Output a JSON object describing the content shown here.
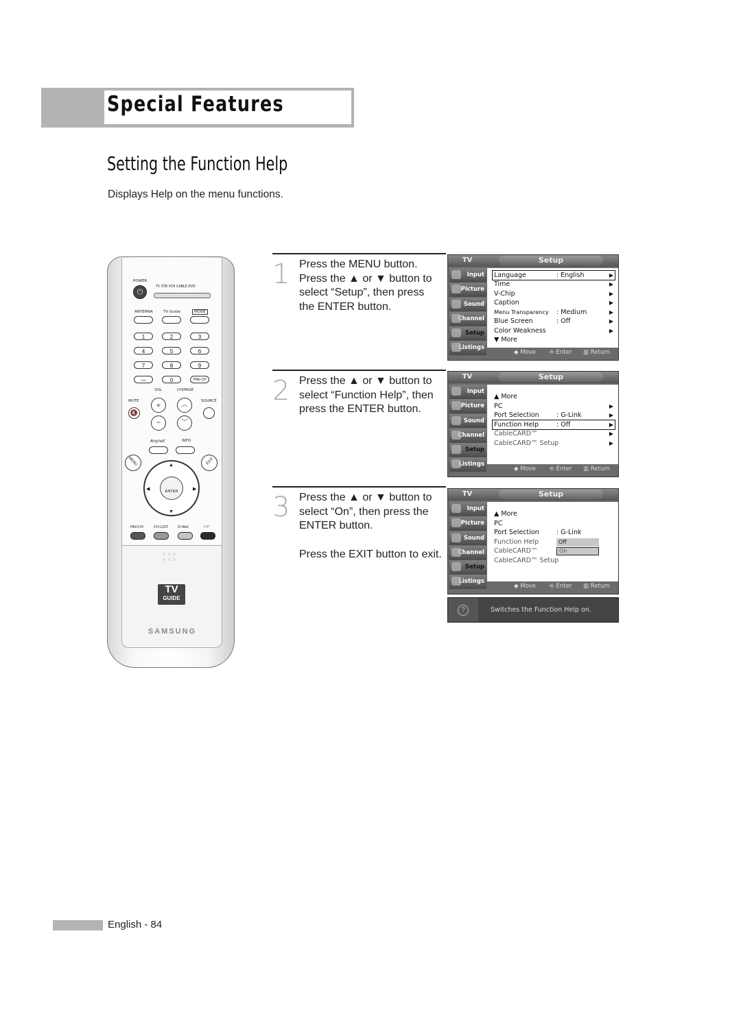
{
  "header": {
    "section": "Special Features"
  },
  "page": {
    "title": "Setting the Function Help",
    "intro": "Displays Help on the menu functions."
  },
  "steps": [
    {
      "number": "1",
      "lines": [
        "Press the MENU button.",
        "Press the ▲ or ▼ button to",
        "select “Setup”, then press",
        "the ENTER button."
      ]
    },
    {
      "number": "2",
      "lines": [
        "Press the ▲ or ▼ button to",
        "select “Function Help”, then",
        "press the ENTER button."
      ]
    },
    {
      "number": "3",
      "lines": [
        "Press the ▲ or ▼ button to",
        "select “On”, then press the",
        "ENTER button."
      ],
      "extra": "Press the EXIT button to exit."
    }
  ],
  "osd": {
    "tv_label": "TV",
    "title": "Setup",
    "sidebar": [
      "Input",
      "Picture",
      "Sound",
      "Channel",
      "Setup",
      "Listings"
    ],
    "hints": {
      "move": "◆ Move",
      "enter": "Enter",
      "return": "Return"
    },
    "screen1": [
      {
        "label": "Language",
        "value": ": English",
        "arrow": "▶"
      },
      {
        "label": "Time",
        "value": "",
        "arrow": "▶"
      },
      {
        "label": "V-Chip",
        "value": "",
        "arrow": "▶"
      },
      {
        "label": "Caption",
        "value": "",
        "arrow": "▶"
      },
      {
        "label": "Menu Transparency",
        "value": ": Medium",
        "arrow": "▶"
      },
      {
        "label": "Blue Screen",
        "value": ": Off",
        "arrow": "▶"
      },
      {
        "label": "Color Weakness",
        "value": "",
        "arrow": "▶"
      },
      {
        "label": "▼ More",
        "value": "",
        "arrow": ""
      }
    ],
    "screen2": [
      {
        "label": "▲ More",
        "value": "",
        "arrow": ""
      },
      {
        "label": "PC",
        "value": "",
        "arrow": "▶"
      },
      {
        "label": "Port Selection",
        "value": ": G-Link",
        "arrow": "▶"
      },
      {
        "label": "Function Help",
        "value": ": Off",
        "arrow": "▶"
      },
      {
        "label": "CableCARD™",
        "value": "",
        "arrow": "▶"
      },
      {
        "label": "CableCARD™ Setup",
        "value": "",
        "arrow": "▶"
      }
    ],
    "screen3": [
      {
        "label": "▲ More",
        "value": ""
      },
      {
        "label": "PC",
        "value": ""
      },
      {
        "label": "Port Selection",
        "value": ": G-Link"
      },
      {
        "label": "Function Help",
        "value": ""
      },
      {
        "label": "CableCARD™",
        "value": ""
      },
      {
        "label": "CableCARD™ Setup",
        "value": ""
      }
    ],
    "options": [
      "Off",
      "On"
    ],
    "help_text": "Switches the Function Help on."
  },
  "remote": {
    "power": "POWER",
    "modes": "TV  STB  VCR  CABLE  DVD",
    "antenna": "ANTENNA",
    "tvguide": "TV Guide",
    "mode": "MODE",
    "numbers": [
      "1",
      "2",
      "3",
      "4",
      "5",
      "6",
      "7",
      "8",
      "9",
      "—",
      "0",
      "PRE-CH"
    ],
    "vol": "VOL",
    "chpage": "CH/PAGE",
    "mute": "MUTE",
    "source": "SOURCE",
    "anynet": "Anynet",
    "info": "INFO",
    "menu": "MENU",
    "exit": "EXIT",
    "enter": "ENTER",
    "color_buttons": [
      "FAV.CH",
      "CH.LIST",
      "D-Net",
      "PIP"
    ],
    "logo_tv": "TV",
    "logo_guide": "GUIDE",
    "brand": "SAMSUNG"
  },
  "footer": {
    "page_label": "English - 84"
  }
}
